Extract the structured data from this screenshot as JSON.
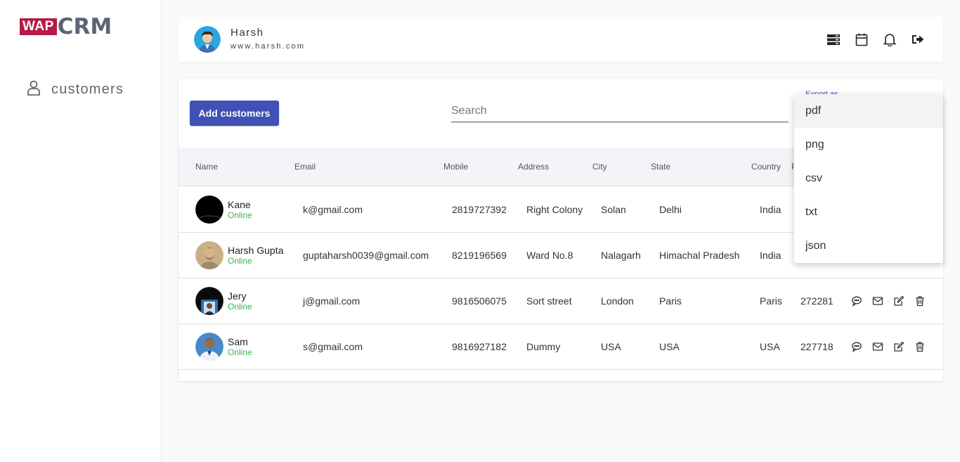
{
  "brand": {
    "logo_left": "WAP",
    "logo_right": "CRM"
  },
  "sidebar": {
    "items": [
      {
        "label": "customers",
        "icon": "user-icon"
      }
    ]
  },
  "header": {
    "user_name": "Harsh",
    "user_site": "www.harsh.com",
    "icons": [
      "storage-icon",
      "calendar-icon",
      "bell-icon",
      "logout-icon"
    ]
  },
  "toolbar": {
    "add_label": "Add customers",
    "search_placeholder": "Search",
    "export_label": "Export as"
  },
  "table": {
    "headers": [
      "Name",
      "Email",
      "Mobile",
      "Address",
      "City",
      "State",
      "Country",
      "P"
    ],
    "rows": [
      {
        "name": "Kane",
        "status": "Online",
        "email": "k@gmail.com",
        "mobile": "2819727392",
        "address": "Right Colony",
        "city": "Solan",
        "state": "Delhi",
        "country": "India",
        "pin": ""
      },
      {
        "name": "Harsh Gupta",
        "status": "Online",
        "email": "guptaharsh0039@gmail.com",
        "mobile": "8219196569",
        "address": "Ward No.8",
        "city": "Nalagarh",
        "state": "Himachal Pradesh",
        "country": "India",
        "pin": ""
      },
      {
        "name": "Jery",
        "status": "Online",
        "email": "j@gmail.com",
        "mobile": "9816506075",
        "address": "Sort street",
        "city": "London",
        "state": "Paris",
        "country": "Paris",
        "pin": "272281"
      },
      {
        "name": "Sam",
        "status": "Online",
        "email": "s@gmail.com",
        "mobile": "9816927182",
        "address": "Dummy",
        "city": "USA",
        "state": "USA",
        "country": "USA",
        "pin": "227718"
      }
    ],
    "row_actions": [
      "chat-icon",
      "mail-icon",
      "edit-icon",
      "delete-icon"
    ]
  },
  "export_menu": {
    "options": [
      "pdf",
      "png",
      "csv",
      "txt",
      "json"
    ],
    "highlighted": "pdf"
  },
  "colors": {
    "primary": "#3f51b5",
    "online": "#3bb54a",
    "brand_red": "#b51a45",
    "brand_gray": "#5b6476"
  }
}
